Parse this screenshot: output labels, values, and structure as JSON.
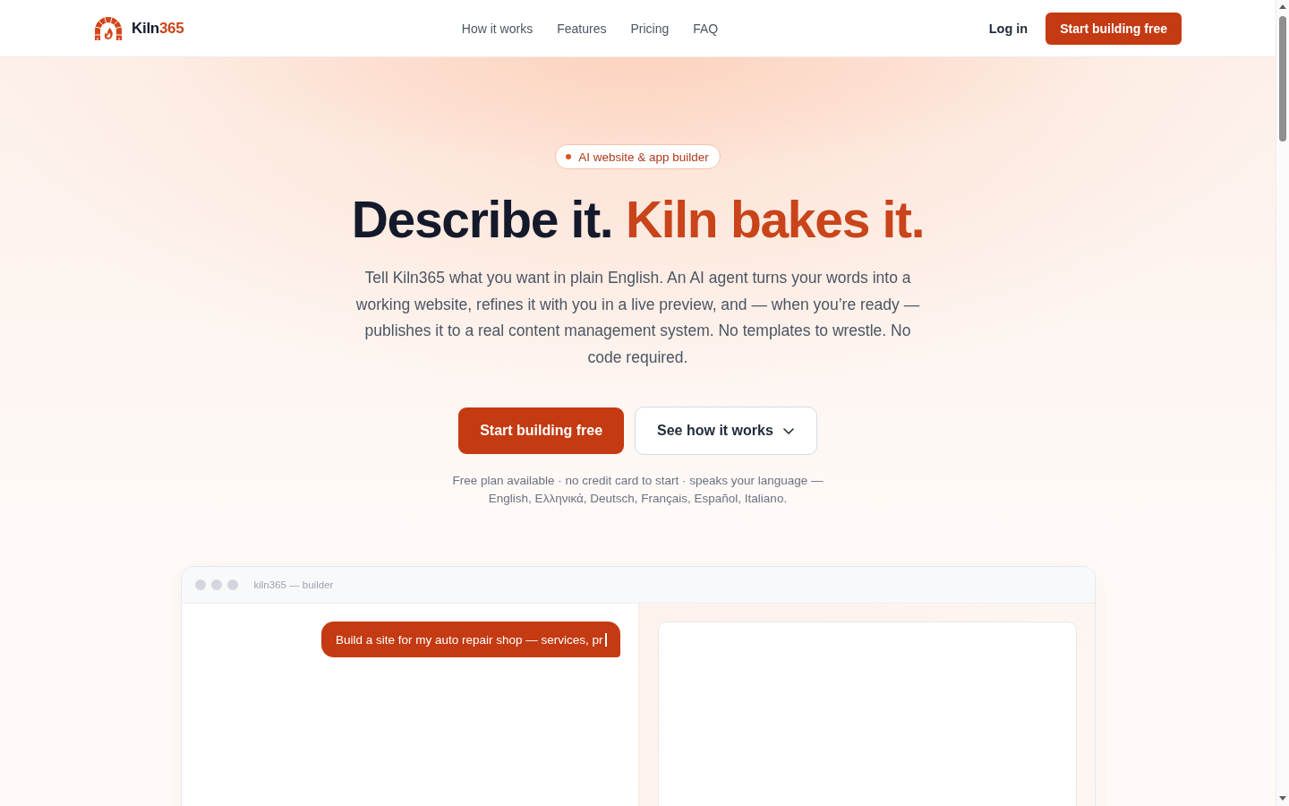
{
  "nav": {
    "brand": {
      "name": "Kiln",
      "accent": "365"
    },
    "links": [
      "How it works",
      "Features",
      "Pricing",
      "FAQ"
    ],
    "login": "Log in",
    "cta": "Start building free"
  },
  "hero": {
    "badge": "AI website & app builder",
    "headline": {
      "text": "Describe it.",
      "accent": "Kiln bakes it."
    },
    "description": "Tell Kiln365 what you want in plain English. An AI agent turns your words into a working website, refines it with you in a live preview, and — when you’re ready — publishes it to a real content management system. No templates to wrestle. No code required.",
    "primary_button": "Start building free",
    "secondary_button": "See how it works",
    "note": "Free plan available · no credit card to start · speaks your language — English, Ελληνικά, Deutsch, Français, Español, Italiano."
  },
  "builder": {
    "title": "kiln365 — builder",
    "prompt": "Build a site for my auto repair shop — services, pr"
  }
}
